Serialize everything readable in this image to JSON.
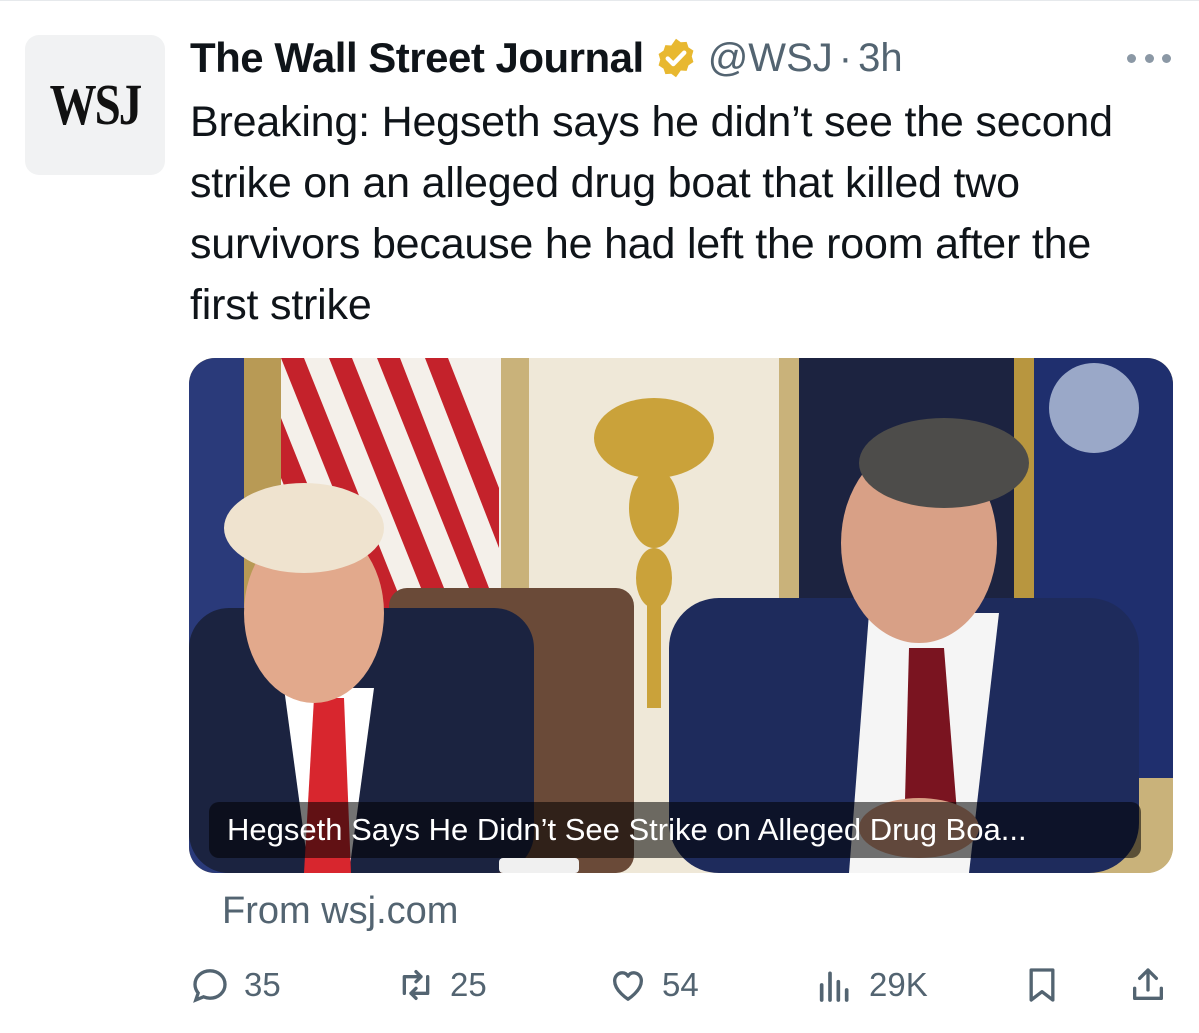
{
  "tweet": {
    "avatar_text": "WSJ",
    "author_name": "The Wall Street Journal",
    "handle": "@WSJ",
    "separator": "·",
    "time": "3h",
    "text": "Breaking: Hegseth says he didn’t see the second strike on an alleged drug boat that killed two survivors because he had left the room after the first strike",
    "verified_color": "#e8b830"
  },
  "card": {
    "title": "Hegseth Says He Didn’t See Strike on Alleged Drug Boa...",
    "source": "From wsj.com"
  },
  "actions": {
    "reply": {
      "icon": "reply-icon",
      "count": "35"
    },
    "retweet": {
      "icon": "retweet-icon",
      "count": "25"
    },
    "like": {
      "icon": "heart-icon",
      "count": "54"
    },
    "views": {
      "icon": "views-icon",
      "count": "29K"
    },
    "bookmark": {
      "icon": "bookmark-icon"
    },
    "share": {
      "icon": "share-icon"
    }
  }
}
